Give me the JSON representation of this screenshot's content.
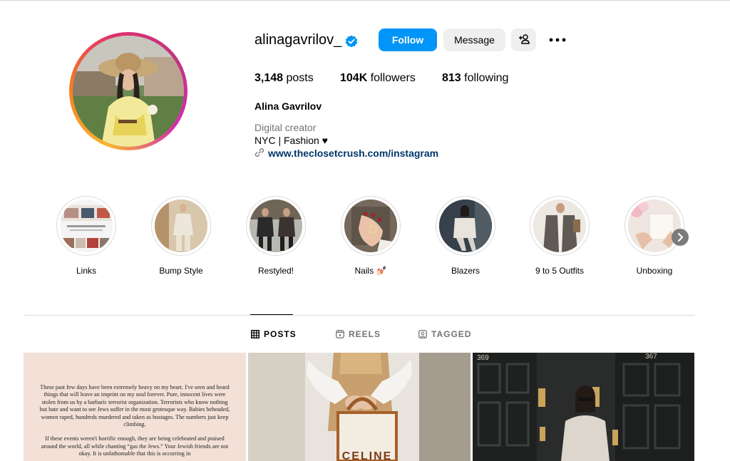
{
  "profile": {
    "username": "alinagavrilov_",
    "follow_label": "Follow",
    "message_label": "Message",
    "stats": {
      "posts_value": "3,148",
      "posts_label": "posts",
      "followers_value": "104K",
      "followers_label": "followers",
      "following_value": "813",
      "following_label": "following"
    },
    "full_name": "Alina Gavrilov",
    "category": "Digital creator",
    "bio": "NYC | Fashion ♥",
    "link": "www.theclosetcrush.com/instagram"
  },
  "highlights": [
    {
      "label": "Links"
    },
    {
      "label": "Bump Style"
    },
    {
      "label": "Restyled!"
    },
    {
      "label": "Nails 💅🏻"
    },
    {
      "label": "Blazers"
    },
    {
      "label": "9 to 5 Outfits"
    },
    {
      "label": "Unboxing"
    }
  ],
  "tabs": [
    {
      "label": "POSTS"
    },
    {
      "label": "REELS"
    },
    {
      "label": "TAGGED"
    }
  ],
  "posts": {
    "post1_paragraph1": "These past few days have been extremely heavy on my heart. I've seen and heard things that will leave an imprint on my soul forever. Pure, innocent lives were stolen from us by a barbaric terrorist organization. Terrorists who know nothing but hate and want to see Jews suffer in the most grotesque way. Babies beheaded, women raped, hundreds murdered and taken as hostages. The numbers just keep climbing.",
    "post1_paragraph2": "If these events weren't horrific enough, they are being celebrated and praised around the world, all while chanting “gas the Jews.” Your Jewish friends are not okay. It is unfathomable that this is occurring in",
    "post2_bag_text": "CELINE",
    "post3_door_left": "369",
    "post3_door_right": "367"
  },
  "colors": {
    "follow_blue": "#0095f6",
    "link_blue": "#00376b",
    "verified_blue": "#0095f6"
  }
}
